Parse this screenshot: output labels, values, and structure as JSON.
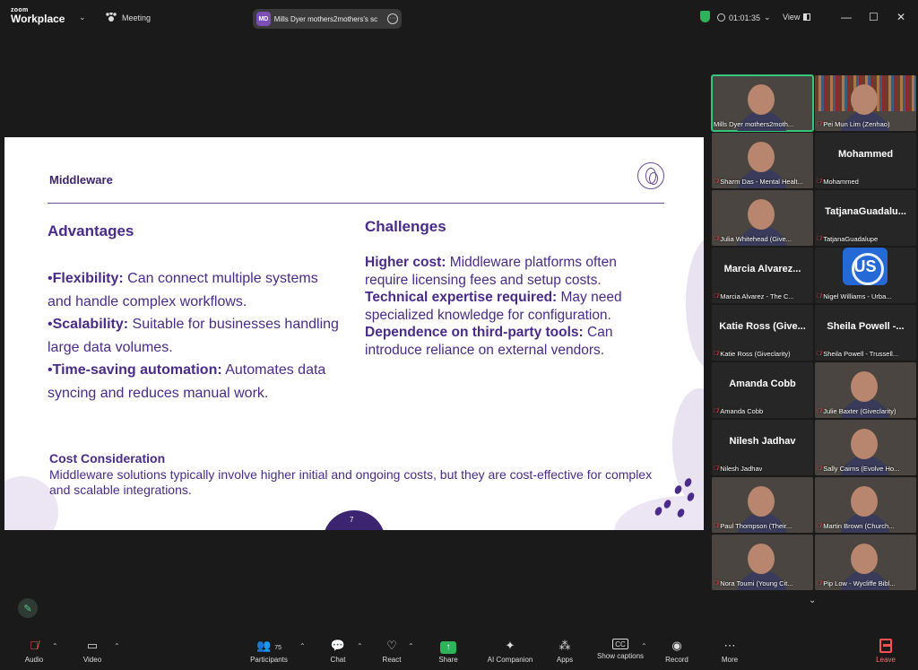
{
  "titlebar": {
    "logo_top": "zoom",
    "logo_bottom": "Workplace",
    "meeting_label": "Meeting",
    "share_initials": "MD",
    "share_text": "Mills Dyer mothers2mothers's sc",
    "timer": "01:01:35",
    "view_label": "View",
    "minimize": "—",
    "maximize": "☐",
    "close": "✕"
  },
  "slide": {
    "title": "Middleware",
    "advantages_heading": "Advantages",
    "advantages": [
      {
        "bullet": "•",
        "term": "Flexibility:",
        "text": " Can connect multiple systems and handle complex workflows."
      },
      {
        "bullet": "•",
        "term": "Scalability:",
        "text": " Suitable for businesses handling large data volumes."
      },
      {
        "bullet": "•",
        "term": "Time-saving automation:",
        "text": " Automates data syncing and reduces manual work."
      }
    ],
    "challenges_heading": "Challenges",
    "challenges": [
      {
        "term": "Higher cost:",
        "text": " Middleware platforms often require licensing fees and setup costs."
      },
      {
        "term": "Technical expertise required:",
        "text": " May need specialized knowledge for configuration."
      },
      {
        "term": "Dependence on third-party tools:",
        "text": " Can introduce reliance on external vendors."
      }
    ],
    "cost_heading": "Cost Consideration",
    "cost_text": "Middleware solutions typically involve higher initial and ongoing costs, but they are cost-effective for complex and scalable integrations.",
    "page_number": "7"
  },
  "participants": [
    {
      "label": "Mills Dyer mothers2moth...",
      "big": "",
      "type": "video",
      "muted": false,
      "active": true
    },
    {
      "label": "Pei Mun Lim (Zenhao)",
      "big": "",
      "type": "video-shelf",
      "muted": true,
      "active": false
    },
    {
      "label": "Sharm Das - Mental Healt...",
      "big": "",
      "type": "video",
      "muted": true,
      "active": false
    },
    {
      "label": "Mohammed",
      "big": "Mohammed",
      "type": "name",
      "muted": true,
      "active": false
    },
    {
      "label": "Julia Whitehead (Give...",
      "big": "",
      "type": "video",
      "muted": true,
      "active": false
    },
    {
      "label": "TatjanaGuadalupe",
      "big": "TatjanaGuadalu...",
      "type": "name",
      "muted": true,
      "active": false
    },
    {
      "label": "Marcia Alvarez - The C...",
      "big": "Marcia  Alvarez...",
      "type": "name",
      "muted": true,
      "active": false
    },
    {
      "label": "Nigel Williams - Urba...",
      "big": "",
      "type": "logo",
      "logo_text": "US",
      "muted": true,
      "active": false
    },
    {
      "label": "Katie Ross (Giveclarity)",
      "big": "Katie  Ross  (Give...",
      "type": "name",
      "muted": true,
      "active": false
    },
    {
      "label": "Sheila Powell - Trussell...",
      "big": "Sheila  Powell  -...",
      "type": "name",
      "muted": true,
      "active": false
    },
    {
      "label": "Amanda Cobb",
      "big": "Amanda Cobb",
      "type": "name",
      "muted": true,
      "active": false
    },
    {
      "label": "Julie Baxter (Giveclarity)",
      "big": "",
      "type": "video",
      "muted": true,
      "active": false
    },
    {
      "label": "Nilesh Jadhav",
      "big": "Nilesh Jadhav",
      "type": "name",
      "muted": true,
      "active": false
    },
    {
      "label": "Sally Cairns (Evolve Ho...",
      "big": "",
      "type": "video",
      "muted": true,
      "active": false
    },
    {
      "label": "Paul Thompson (Their...",
      "big": "",
      "type": "video",
      "muted": true,
      "active": false
    },
    {
      "label": "Martin Brown (Church...",
      "big": "",
      "type": "video",
      "muted": true,
      "active": false
    },
    {
      "label": "Nora Toumi (Young Cit...",
      "big": "",
      "type": "video",
      "muted": true,
      "active": false
    },
    {
      "label": "Pip Low - Wycliffe Bibl...",
      "big": "",
      "type": "video",
      "muted": true,
      "active": false
    }
  ],
  "toolbar": {
    "audio": "Audio",
    "video": "Video",
    "participants": "Participants",
    "participants_count": "75",
    "chat": "Chat",
    "react": "React",
    "share": "Share",
    "ai_companion": "AI Companion",
    "apps": "Apps",
    "show_captions": "Show captions",
    "record": "Record",
    "more": "More",
    "leave": "Leave"
  },
  "icons": {
    "mic_muted": "mic-muted-icon",
    "camera": "camera-icon"
  },
  "colors": {
    "accent_green": "#2fb35a",
    "slide_purple": "#4a2b8a",
    "muted_red": "#ff4d4d"
  }
}
